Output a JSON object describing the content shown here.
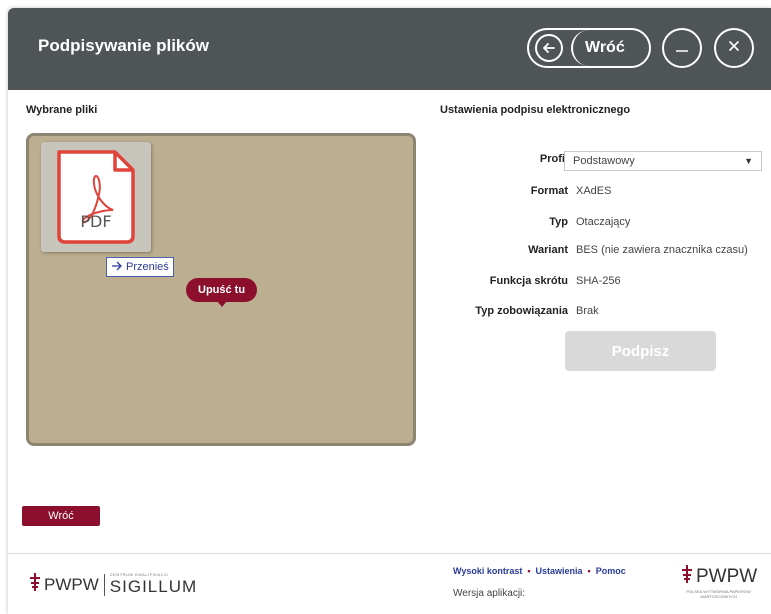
{
  "header": {
    "title": "Podpisywanie plików",
    "back_label": "Wróć",
    "minimize_icon": "minimize-icon",
    "close_icon": "close-icon"
  },
  "left": {
    "section_title": "Wybrane pliki",
    "file_type": "PDF",
    "move_label": "Przenieś",
    "drop_label": "Upuść tu"
  },
  "right": {
    "section_title": "Ustawienia podpisu elektronicznego",
    "rows": [
      {
        "label": "Profil",
        "value": "Podstawowy"
      },
      {
        "label": "Format",
        "value": "XAdES"
      },
      {
        "label": "Typ",
        "value": "Otaczający"
      },
      {
        "label": "Wariant",
        "value": "BES (nie zawiera znacznika czasu)"
      },
      {
        "label": "Funkcja skrótu",
        "value": "SHA-256"
      },
      {
        "label": "Typ zobowiązania",
        "value": "Brak"
      }
    ],
    "sign_label": "Podpisz"
  },
  "bottom_back_label": "Wróć",
  "footer": {
    "links": [
      "Wysoki kontrast",
      "Ustawienia",
      "Pomoc"
    ],
    "version_label": "Wersja aplikacji:",
    "logo_left_text": "PWPW",
    "logo_left_small": "CENTRUM KWALIFIKACJI",
    "logo_left_brand": "SIGILLUM",
    "logo_right_text": "PWPW",
    "logo_right_small": "POLSKA WYTWÓRNIA PAPIERÓW WARTOŚCIOWYCH"
  },
  "colors": {
    "header_bg": "#4f5457",
    "accent": "#8c0f2d",
    "dropzone_bg": "#bcae90",
    "link": "#2a3b9a",
    "pdf_red": "#e0433a"
  }
}
